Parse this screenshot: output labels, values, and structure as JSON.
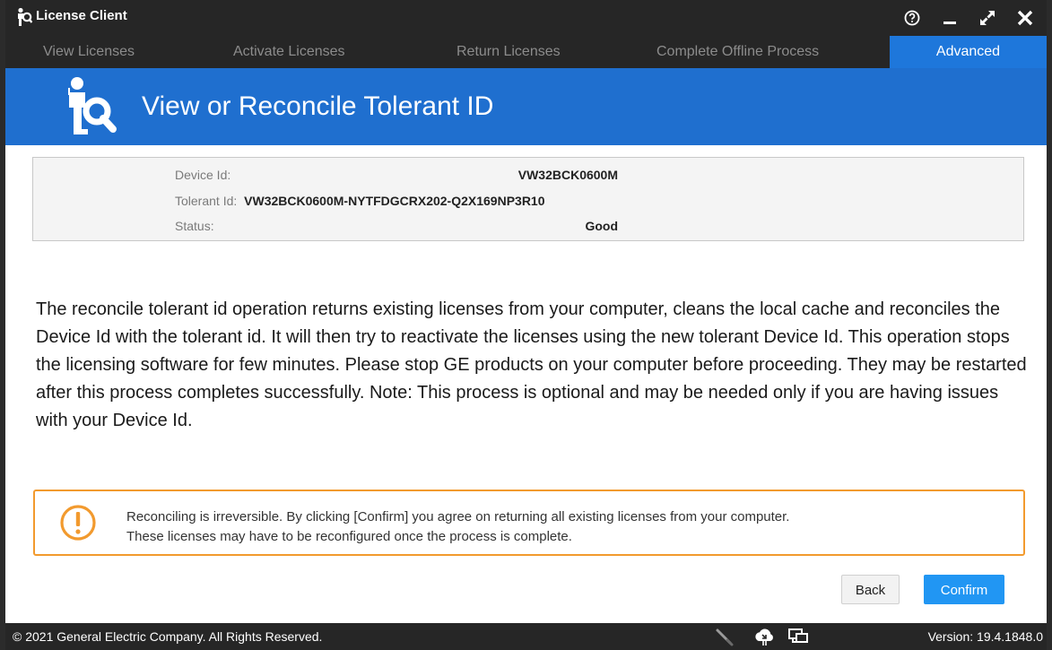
{
  "window": {
    "title": "License Client",
    "controls": {
      "help_icon": "help-circle-icon",
      "minimize_icon": "minimize-icon",
      "maximize_icon": "maximize-icon",
      "close_icon": "close-icon"
    }
  },
  "tabs": [
    {
      "label": "View Licenses",
      "active": false
    },
    {
      "label": "Activate Licenses",
      "active": false
    },
    {
      "label": "Return Licenses",
      "active": false
    },
    {
      "label": "Complete Offline Process",
      "active": false
    },
    {
      "label": "Advanced",
      "active": true
    }
  ],
  "banner": {
    "title": "View or Reconcile Tolerant ID",
    "icon": "person-search-icon",
    "color": "#1f6fcf"
  },
  "info": {
    "device_id_label": "Device Id:",
    "device_id_value": "VW32BCK0600M",
    "tolerant_id_label": "Tolerant Id:",
    "tolerant_id_value": "VW32BCK0600M-NYTFDGCRX202-Q2X169NP3R10",
    "status_label": "Status:",
    "status_value": "Good"
  },
  "description": "The reconcile tolerant id operation returns existing licenses from your computer, cleans the local cache and reconciles the Device Id with the tolerant id. It will then try to reactivate the licenses using the new tolerant Device Id. This operation stops the licensing software for few minutes. Please stop GE products on your computer before proceeding. They may be restarted after this process completes successfully. Note: This process is optional and may be needed only if you are having issues with your Device Id.",
  "warning": {
    "icon": "exclamation-circle-icon",
    "line1": "Reconciling is irreversible. By clicking [Confirm] you agree on returning all existing licenses from your computer.",
    "line2": "These licenses may have to be reconfigured once the process is complete.",
    "color": "#f29a2e"
  },
  "buttons": {
    "back_label": "Back",
    "confirm_label": "Confirm",
    "confirm_color": "#2196f3"
  },
  "statusbar": {
    "copyright": "© 2021 General Electric Company.  All Rights Reserved.",
    "version": "Version:  19.4.1848.0",
    "icons": [
      "plug-icon",
      "cloud-sync-icon",
      "monitor-icon"
    ]
  }
}
